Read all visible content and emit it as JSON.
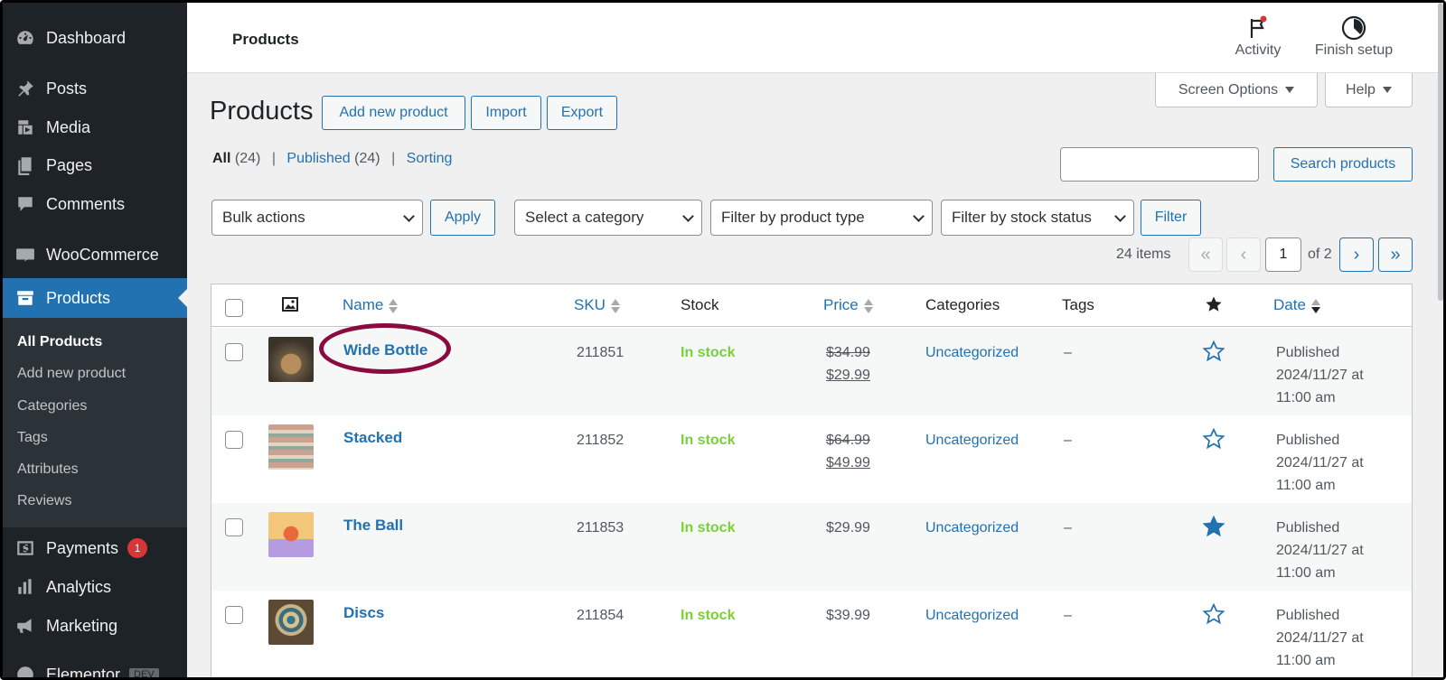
{
  "sidebar": {
    "items": [
      {
        "label": "Dashboard",
        "icon": "dashboard-icon"
      },
      {
        "label": "Posts",
        "icon": "pin-icon"
      },
      {
        "label": "Media",
        "icon": "media-icon"
      },
      {
        "label": "Pages",
        "icon": "pages-icon"
      },
      {
        "label": "Comments",
        "icon": "comment-icon"
      },
      {
        "label": "WooCommerce",
        "icon": "woo-icon"
      },
      {
        "label": "Products",
        "icon": "archive-icon"
      },
      {
        "label": "Payments",
        "icon": "dollar-icon",
        "badge": "1"
      },
      {
        "label": "Analytics",
        "icon": "bar-chart-icon"
      },
      {
        "label": "Marketing",
        "icon": "megaphone-icon"
      },
      {
        "label": "Elementor",
        "icon": "elementor-icon",
        "tag": "DEV"
      }
    ],
    "submenu": [
      "All Products",
      "Add new product",
      "Categories",
      "Tags",
      "Attributes",
      "Reviews"
    ]
  },
  "header": {
    "title": "Products",
    "activity": "Activity",
    "finish_setup": "Finish setup"
  },
  "screen_options": "Screen Options",
  "help": "Help",
  "page": {
    "title": "Products",
    "add_new": "Add new product",
    "import": "Import",
    "export": "Export"
  },
  "views": {
    "all": "All",
    "all_count": "(24)",
    "published": "Published",
    "published_count": "(24)",
    "sorting": "Sorting"
  },
  "search": {
    "button": "Search products",
    "value": ""
  },
  "filters": {
    "bulk_actions": "Bulk actions",
    "apply": "Apply",
    "category": "Select a category",
    "product_type": "Filter by product type",
    "stock_status": "Filter by stock status",
    "filter": "Filter"
  },
  "pagination": {
    "items": "24 items",
    "first": "«",
    "prev": "‹",
    "current_page": "1",
    "of": "of 2",
    "next": "›",
    "last": "»"
  },
  "table": {
    "columns": [
      "Name",
      "SKU",
      "Stock",
      "Price",
      "Categories",
      "Tags",
      "Date"
    ],
    "rows": [
      {
        "name": "Wide Bottle",
        "sku": "211851",
        "stock": "In stock",
        "price_regular": "$34.99",
        "price_sale": "$29.99",
        "category": "Uncategorized",
        "tags": "–",
        "featured": false,
        "date_status": "Published",
        "date_line": "2024/11/27 at",
        "date_time": "11:00 am"
      },
      {
        "name": "Stacked",
        "sku": "211852",
        "stock": "In stock",
        "price_regular": "$64.99",
        "price_sale": "$49.99",
        "category": "Uncategorized",
        "tags": "–",
        "featured": false,
        "date_status": "Published",
        "date_line": "2024/11/27 at",
        "date_time": "11:00 am"
      },
      {
        "name": "The Ball",
        "sku": "211853",
        "stock": "In stock",
        "price_regular": "$29.99",
        "price_sale": "",
        "category": "Uncategorized",
        "tags": "–",
        "featured": true,
        "date_status": "Published",
        "date_line": "2024/11/27 at",
        "date_time": "11:00 am"
      },
      {
        "name": "Discs",
        "sku": "211854",
        "stock": "In stock",
        "price_regular": "$39.99",
        "price_sale": "",
        "category": "Uncategorized",
        "tags": "–",
        "featured": false,
        "date_status": "Published",
        "date_line": "2024/11/27 at",
        "date_time": "11:00 am"
      }
    ]
  },
  "colors": {
    "admin_sidebar": "#1d2327",
    "accent": "#2271b1",
    "in_stock": "#7ad03a",
    "annotation_ring": "#8b0a3f"
  }
}
